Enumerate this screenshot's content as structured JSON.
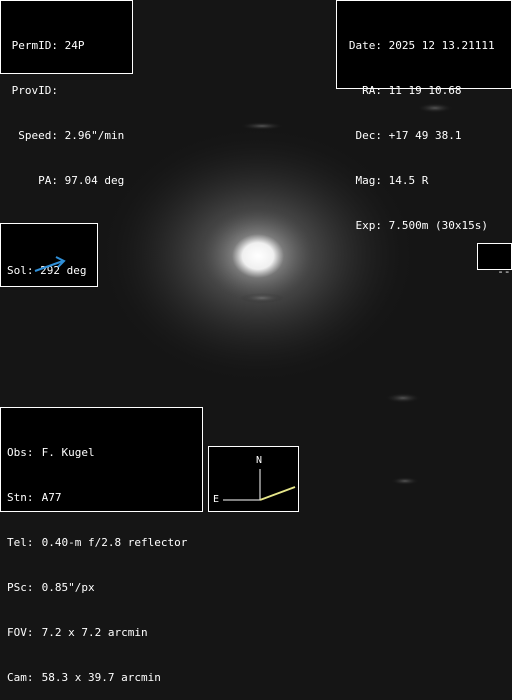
{
  "object": {
    "perm_id_label": "PermID:",
    "perm_id": "24P",
    "prov_id_label": "ProvID:",
    "prov_id": "",
    "speed_label": "Speed:",
    "speed": "2.96\"/min",
    "pa_label": "PA:",
    "pa": "97.04 deg"
  },
  "position": {
    "date_label": "Date:",
    "date": "2025 12 13.21111",
    "ra_label": "RA:",
    "ra": "11 19 10.68",
    "dec_label": "Dec:",
    "dec": "+17 49 38.1",
    "mag_label": "Mag:",
    "mag": "14.5 R",
    "exp_label": "Exp:",
    "exp": "7.500m (30x15s)"
  },
  "sol": {
    "label": "Sol:",
    "value": "292 deg",
    "arrow_color": "#2f8fd8",
    "arrow_icon": "sun-direction-arrow-icon"
  },
  "motion": {
    "value": "---"
  },
  "observer": {
    "obs_label": "Obs:",
    "obs": "F. Kugel",
    "stn_label": "Stn:",
    "stn": "A77",
    "tel_label": "Tel:",
    "tel": "0.40-m f/2.8 reflector",
    "psc_label": "PSc:",
    "psc": "0.85\"/px",
    "fov_label": "FOV:",
    "fov": "7.2 x 7.2 arcmin",
    "cam_label": "Cam:",
    "cam": "58.3 x 39.7 arcmin"
  },
  "compass": {
    "north": "N",
    "east": "E",
    "motion_color": "#e6e68a"
  },
  "colors": {
    "background": "#151515",
    "panel": "#000000",
    "text": "#ffffff"
  }
}
